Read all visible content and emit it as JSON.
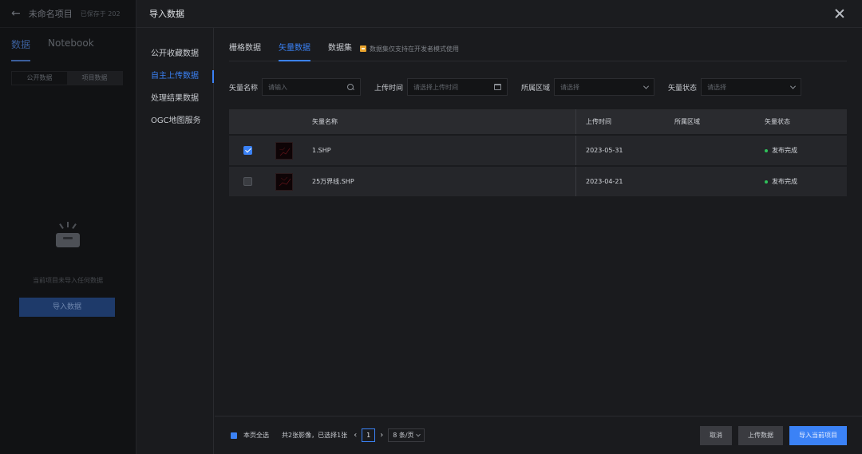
{
  "background": {
    "title": "未命名项目",
    "saved": "已保存于 202",
    "tabs": [
      "数据",
      "Notebook"
    ],
    "subtabs": [
      "公开数据",
      "项目数据"
    ],
    "empty_text": "当前项目未导入任何数据",
    "import_button": "导入数据"
  },
  "modal": {
    "title": "导入数据",
    "nav": [
      "公开收藏数据",
      "自主上传数据",
      "处理结果数据",
      "OGC地图服务"
    ],
    "tabs": [
      "栅格数据",
      "矢量数据",
      "数据集"
    ],
    "dataset_hint": "数据集仅支持在开发者模式使用",
    "filters": {
      "name_label": "矢量名称",
      "name_placeholder": "请输入",
      "time_label": "上传时间",
      "time_placeholder": "请选择上传时间",
      "region_label": "所属区域",
      "region_placeholder": "请选择",
      "status_label": "矢量状态",
      "status_placeholder": "请选择"
    },
    "table": {
      "headers": [
        "矢量名称",
        "上传时间",
        "所属区域",
        "矢量状态"
      ],
      "rows": [
        {
          "checked": true,
          "name": "1.SHP",
          "time": "2023-05-31",
          "region": "",
          "status": "发布完成"
        },
        {
          "checked": false,
          "name": "25万界线.SHP",
          "time": "2023-04-21",
          "region": "",
          "status": "发布完成"
        }
      ]
    },
    "footer": {
      "select_all": "本页全选",
      "summary": "共2张影像，已选择1张",
      "page": "1",
      "page_size": "8 条/页",
      "cancel": "取消",
      "upload": "上传数据",
      "import": "导入当前项目"
    }
  },
  "colors": {
    "accent": "#3b82f6",
    "status_ok": "#2fc15a",
    "hint": "#e8a32e"
  }
}
